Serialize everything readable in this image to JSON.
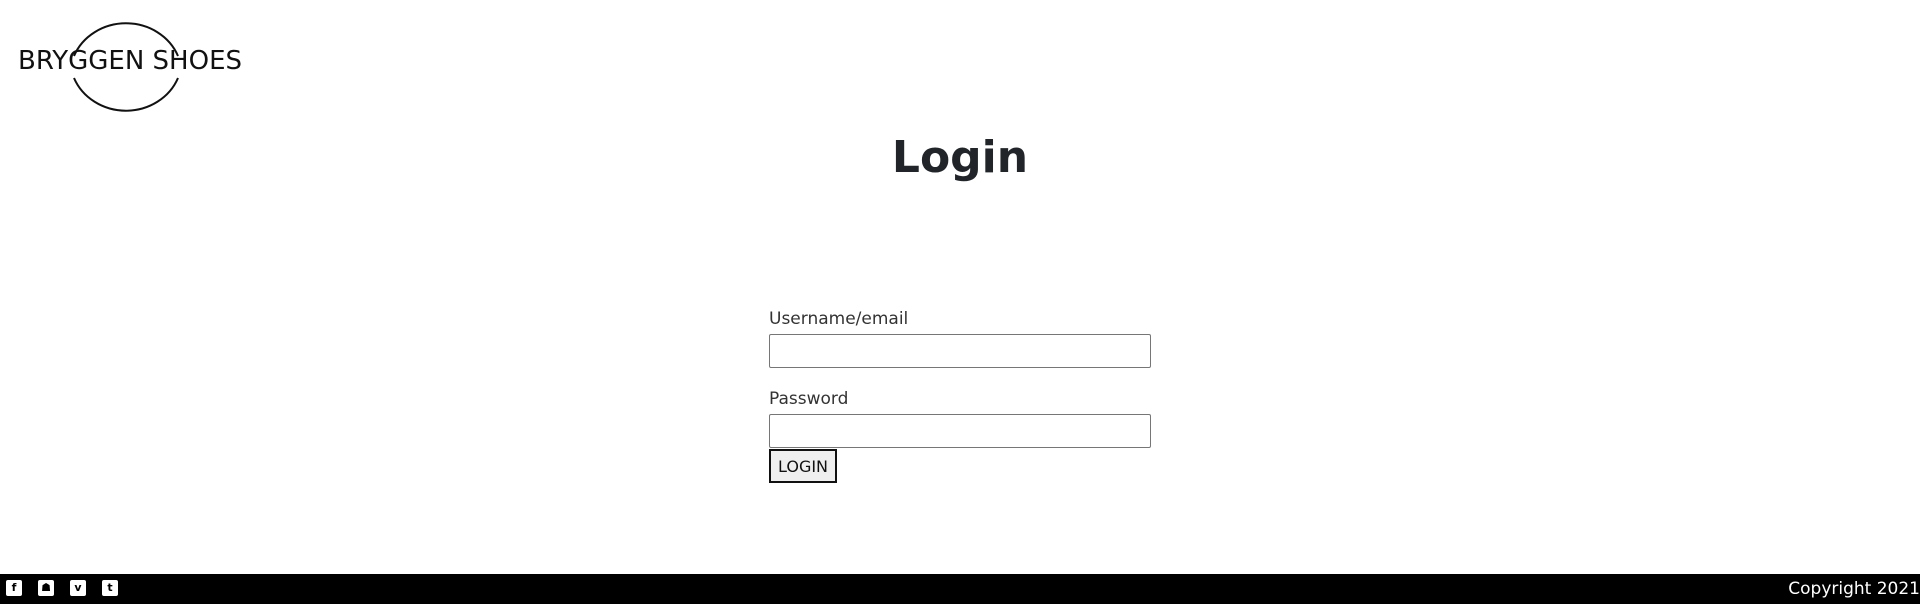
{
  "header": {
    "logo_text": "BRYGGEN SHOES"
  },
  "main": {
    "title": "Login",
    "form": {
      "username_label": "Username/email",
      "username_value": "",
      "password_label": "Password",
      "password_value": "",
      "login_button_label": "LOGIN"
    }
  },
  "footer": {
    "social_icons": [
      {
        "name": "facebook-icon",
        "glyph": "f"
      },
      {
        "name": "snapchat-icon",
        "glyph": "☗"
      },
      {
        "name": "vimeo-icon",
        "glyph": "v"
      },
      {
        "name": "twitter-icon",
        "glyph": "t"
      }
    ],
    "copyright": "Copyright 2021"
  },
  "colors": {
    "background": "#ffffff",
    "footer_background": "#000000",
    "text": "#212529"
  }
}
